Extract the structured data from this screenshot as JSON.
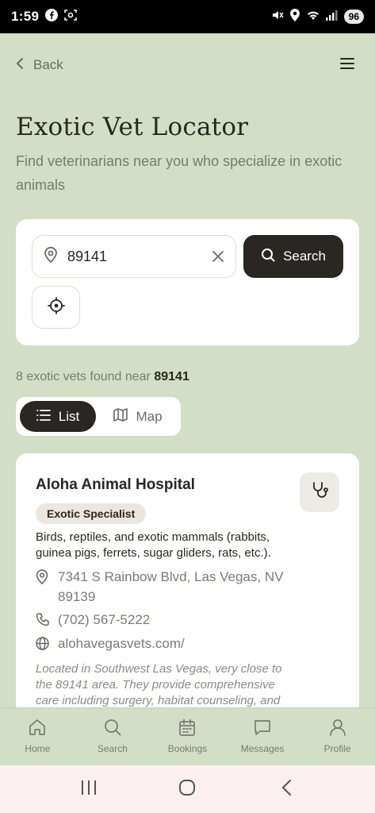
{
  "status_bar": {
    "time": "1:59",
    "battery": "96"
  },
  "header": {
    "back_label": "Back"
  },
  "page": {
    "title": "Exotic Vet Locator",
    "subtitle": "Find veterinarians near you who specialize in exotic animals"
  },
  "search": {
    "value": "89141",
    "button_label": "Search"
  },
  "results": {
    "count_prefix": "8 exotic vets found near",
    "zip": "89141"
  },
  "view_toggle": {
    "list_label": "List",
    "map_label": "Map"
  },
  "vet": {
    "name": "Aloha Animal Hospital",
    "badge": "Exotic Specialist",
    "specialty": "Birds, reptiles, and exotic mammals (rabbits, guinea pigs, ferrets, sugar gliders, rats, etc.).",
    "address": "7341 S Rainbow Blvd, Las Vegas, NV 89139",
    "phone": "(702) 567-5222",
    "website": "alohavegasvets.com/",
    "description": "Located in Southwest Las Vegas, very close to the 89141 area. They provide comprehensive care including surgery, habitat counseling, and"
  },
  "bottom_nav": {
    "home": "Home",
    "search": "Search",
    "bookings": "Bookings",
    "messages": "Messages",
    "profile": "Profile"
  },
  "colors": {
    "background": "#d2dfc6",
    "dark": "#2a2622",
    "card": "#ffffff",
    "muted": "#7a7a74"
  }
}
